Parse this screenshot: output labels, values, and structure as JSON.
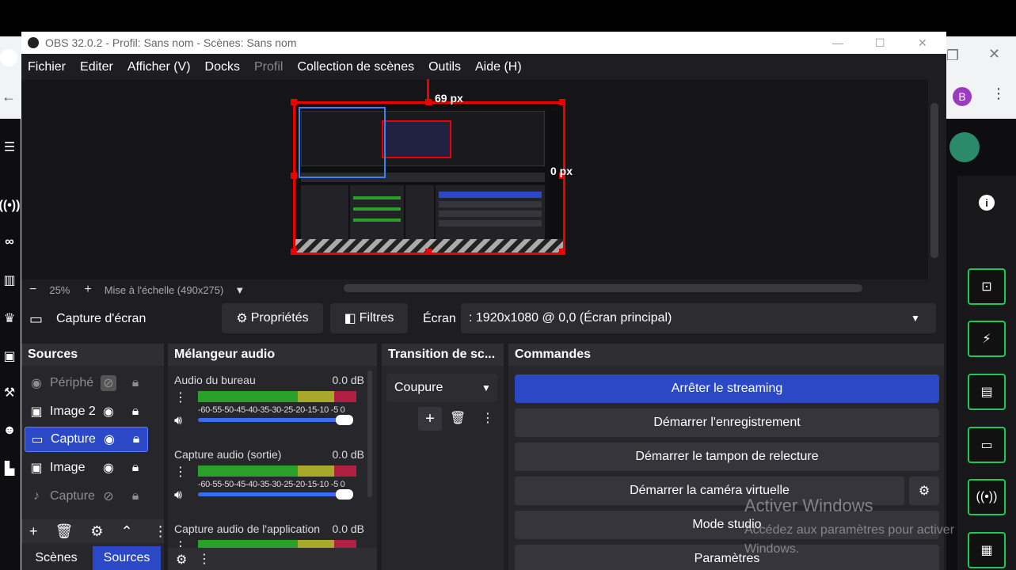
{
  "app_title": "OBS 32.0.2 - Profil: Sans nom - Scènes: Sans nom",
  "menu": [
    "Fichier",
    "Editer",
    "Afficher (V)",
    "Docks",
    "Profil",
    "Collection de scènes",
    "Outils",
    "Aide (H)"
  ],
  "preview": {
    "label_top": "69 px",
    "label_right": "0 px",
    "zoom_minus": "−",
    "zoom": "25%",
    "zoom_plus": "+",
    "scale_mode": "Mise à l'échelle (490x275)"
  },
  "source_bar": {
    "source_name": "Capture d'écran",
    "properties_label": "Propriétés",
    "filters_label": "Filtres",
    "screen_label": "Écran",
    "screen_value": ": 1920x1080 @ 0,0 (Écran principal)"
  },
  "sources": {
    "title": "Sources",
    "items": [
      {
        "name": "Périphé",
        "visible": false
      },
      {
        "name": "Image 2",
        "visible": true
      },
      {
        "name": "Capture",
        "visible": true,
        "selected": true
      },
      {
        "name": "Image",
        "visible": true
      },
      {
        "name": "Capture",
        "visible": false
      }
    ]
  },
  "mixer": {
    "title": "Mélangeur audio",
    "channels": [
      {
        "name": "Audio du bureau",
        "db": "0.0 dB"
      },
      {
        "name": "Capture audio (sortie)",
        "db": "0.0 dB"
      },
      {
        "name": "Capture audio de l'application",
        "db": "0.0 dB"
      }
    ],
    "scale": "-60-55-50-45-40-35-30-25-20-15-10 -5  0"
  },
  "transition": {
    "title": "Transition de sc...",
    "value": "Coupure"
  },
  "commands": {
    "title": "Commandes",
    "buttons": [
      "Arrêter le streaming",
      "Démarrer l'enregistrement",
      "Démarrer le tampon de relecture",
      "Démarrer la caméra virtuelle",
      "Mode studio",
      "Paramètres"
    ]
  },
  "bottom_tabs": [
    "Scènes",
    "Sources"
  ],
  "watermark": {
    "title": "Activer Windows",
    "subtitle": "Accédez aux paramètres pour activer Windows."
  },
  "browser": {
    "avatar_letter": "B"
  },
  "colors": {
    "accent": "#2b49c6",
    "selection": "#e00000",
    "twitch_green": "#1ec95b"
  }
}
